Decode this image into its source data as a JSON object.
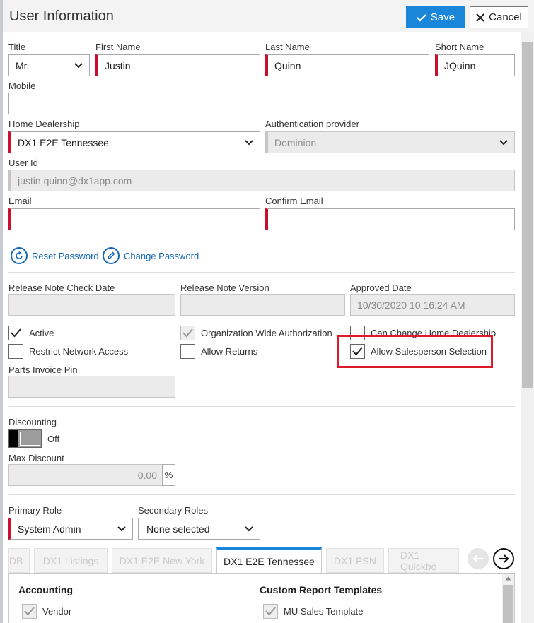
{
  "header": {
    "title": "User Information",
    "save_label": "Save",
    "cancel_label": "Cancel"
  },
  "fields": {
    "title": {
      "label": "Title",
      "value": "Mr."
    },
    "first_name": {
      "label": "First Name",
      "value": "Justin"
    },
    "last_name": {
      "label": "Last Name",
      "value": "Quinn"
    },
    "short_name": {
      "label": "Short Name",
      "value": "JQuinn"
    },
    "mobile": {
      "label": "Mobile",
      "value": ""
    },
    "home_dealership": {
      "label": "Home Dealership",
      "value": "DX1 E2E Tennessee"
    },
    "auth_provider": {
      "label": "Authentication provider",
      "value": "Dominion"
    },
    "user_id": {
      "label": "User Id",
      "value": "justin.quinn@dx1app.com"
    },
    "email": {
      "label": "Email",
      "value": ""
    },
    "confirm_email": {
      "label": "Confirm Email",
      "value": ""
    }
  },
  "actions": {
    "reset_password": "Reset Password",
    "change_password": "Change Password"
  },
  "release": {
    "check_date_label": "Release Note Check Date",
    "check_date_value": "",
    "version_label": "Release Note Version",
    "version_value": "",
    "approved_label": "Approved Date",
    "approved_value": "10/30/2020 10:16:24 AM"
  },
  "checkboxes": {
    "active": {
      "label": "Active",
      "checked": true
    },
    "org_wide": {
      "label": "Organization Wide Authorization",
      "checked": true
    },
    "can_change_home": {
      "label": "Can Change Home Dealership",
      "checked": false
    },
    "restrict_network": {
      "label": "Restrict Network Access",
      "checked": false
    },
    "allow_returns": {
      "label": "Allow Returns",
      "checked": false
    },
    "allow_salesperson": {
      "label": "Allow Salesperson Selection",
      "checked": true
    }
  },
  "parts_invoice_pin": {
    "label": "Parts Invoice Pin",
    "value": ""
  },
  "discounting": {
    "label": "Discounting",
    "state": "Off",
    "max_label": "Max Discount",
    "max_value": "0.00",
    "unit": "%"
  },
  "roles": {
    "primary_label": "Primary Role",
    "primary_value": "System Admin",
    "secondary_label": "Secondary Roles",
    "secondary_value": "None selected"
  },
  "tabs": [
    "DB",
    "DX1 Listings",
    "DX1 E2E New York",
    "DX1 E2E Tennessee",
    "DX1 PSN",
    "DX1 Quickbo"
  ],
  "permissions": {
    "accounting": {
      "heading": "Accounting",
      "items": [
        "Vendor"
      ]
    },
    "custom_reports": {
      "heading": "Custom Report Templates",
      "items": [
        "MU Sales Template"
      ]
    }
  },
  "colors": {
    "accent": "#1a86d9",
    "required": "#c8102e",
    "highlight": "#e0192b"
  }
}
